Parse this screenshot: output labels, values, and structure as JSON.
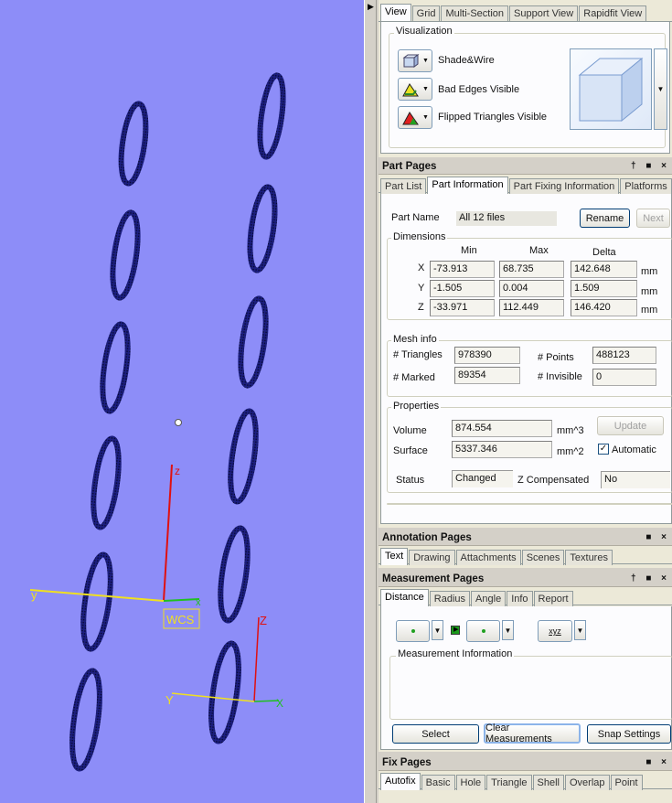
{
  "viewport": {
    "wcs_label": "WCS",
    "axis_labels": {
      "x": "x",
      "y": "y",
      "z": "z"
    },
    "local_axis_labels": {
      "x": "X",
      "y": "Y",
      "z": "Z"
    }
  },
  "top_tabs": [
    "View",
    "Grid",
    "Multi-Section",
    "Support View",
    "Rapidfit View"
  ],
  "visualization": {
    "title": "Visualization",
    "buttons": [
      "Shade&Wire",
      "Bad Edges Visible",
      "Flipped Triangles Visible"
    ]
  },
  "part_pages": {
    "title": "Part Pages",
    "tabs": [
      "Part List",
      "Part Information",
      "Part Fixing Information",
      "Platforms"
    ],
    "part_name_label": "Part Name",
    "part_name_value": "All 12 files",
    "rename": "Rename",
    "next": "Next",
    "dimensions": {
      "title": "Dimensions",
      "headers": [
        "Min",
        "Max",
        "Delta"
      ],
      "rows": [
        {
          "axis": "X",
          "min": "-73.913",
          "max": "68.735",
          "delta": "142.648",
          "unit": "mm"
        },
        {
          "axis": "Y",
          "min": "-1.505",
          "max": "0.004",
          "delta": "1.509",
          "unit": "mm"
        },
        {
          "axis": "Z",
          "min": "-33.971",
          "max": "112.449",
          "delta": "146.420",
          "unit": "mm"
        }
      ]
    },
    "mesh": {
      "title": "Mesh info",
      "triangles_label": "# Triangles",
      "triangles": "978390",
      "points_label": "# Points",
      "points": "488123",
      "marked_label": "# Marked",
      "marked": "89354",
      "invisible_label": "# Invisible",
      "invisible": "0"
    },
    "properties": {
      "title": "Properties",
      "volume_label": "Volume",
      "volume": "874.554",
      "volume_unit": "mm^3",
      "surface_label": "Surface",
      "surface": "5337.346",
      "surface_unit": "mm^2",
      "update": "Update",
      "automatic": "Automatic"
    },
    "status_label": "Status",
    "status": "Changed",
    "zcomp_label": "Z Compensated",
    "zcomp": "No"
  },
  "annotation_pages": {
    "title": "Annotation Pages",
    "tabs": [
      "Text",
      "Drawing",
      "Attachments",
      "Scenes",
      "Textures"
    ]
  },
  "measurement_pages": {
    "title": "Measurement Pages",
    "tabs": [
      "Distance",
      "Radius",
      "Angle",
      "Info",
      "Report"
    ],
    "xyz": "xyz",
    "info_title": "Measurement Information",
    "select": "Select",
    "clear": "Clear Measurements",
    "snap": "Snap Settings"
  },
  "fix_pages": {
    "title": "Fix Pages",
    "tabs": [
      "Autofix",
      "Basic",
      "Hole",
      "Triangle",
      "Shell",
      "Overlap",
      "Point"
    ]
  },
  "panel_buttons": "■ ×",
  "panel_buttons_pin": "† ■ ×",
  "colors": {
    "viewport_bg": "#8d8df8",
    "ring": "#1a1f7a",
    "accent_tab": "#fcfcfe"
  }
}
